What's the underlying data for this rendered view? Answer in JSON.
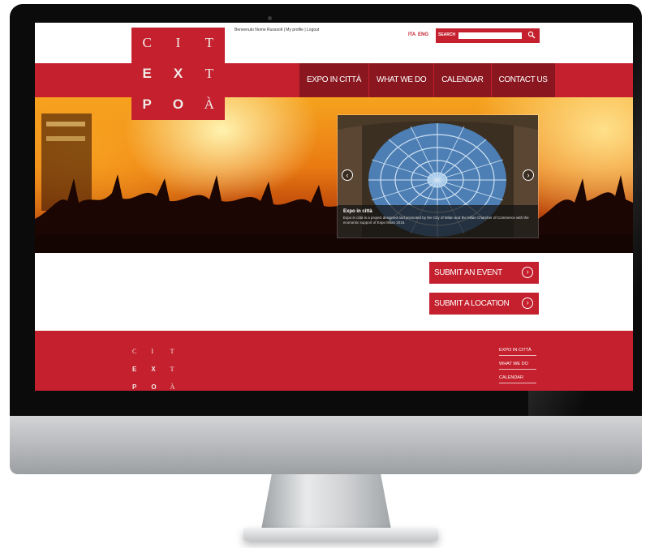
{
  "header": {
    "welcome_text": "Benvenuto Nome Russsolt | My profile | Logout",
    "languages": [
      "ITA",
      "ENG"
    ],
    "search": {
      "label": "SEARCH",
      "value": ""
    }
  },
  "logo": {
    "rows": [
      [
        "C",
        "I",
        "T"
      ],
      [
        "E",
        "X",
        "T"
      ],
      [
        "P",
        "O",
        "À"
      ]
    ]
  },
  "nav": {
    "items": [
      {
        "label": "EXPO IN CITTÀ"
      },
      {
        "label": "WHAT WE DO"
      },
      {
        "label": "CALENDAR"
      },
      {
        "label": "CONTACT US"
      }
    ]
  },
  "slider": {
    "caption_title": "Expo in città",
    "caption_text": "Expo in città is a project designed and promoted by the City of Milan and the Milan Chamber of Commerce with the economic support of Expo Milan 2015.",
    "prev_icon": "chevron-left-icon",
    "next_icon": "chevron-right-icon"
  },
  "actions": {
    "submit_event": "SUBMIT AN EVENT",
    "submit_location": "SUBMIT A LOCATION",
    "arrow_icon": "circle-arrow-right-icon"
  },
  "footer": {
    "links": [
      "EXPO IN CITTÀ",
      "WHAT WE DO",
      "CALENDAR"
    ]
  },
  "colors": {
    "brand_red": "#c4202d",
    "nav_dark_red": "#8a1720",
    "logo_letter": "#f0ece8"
  }
}
